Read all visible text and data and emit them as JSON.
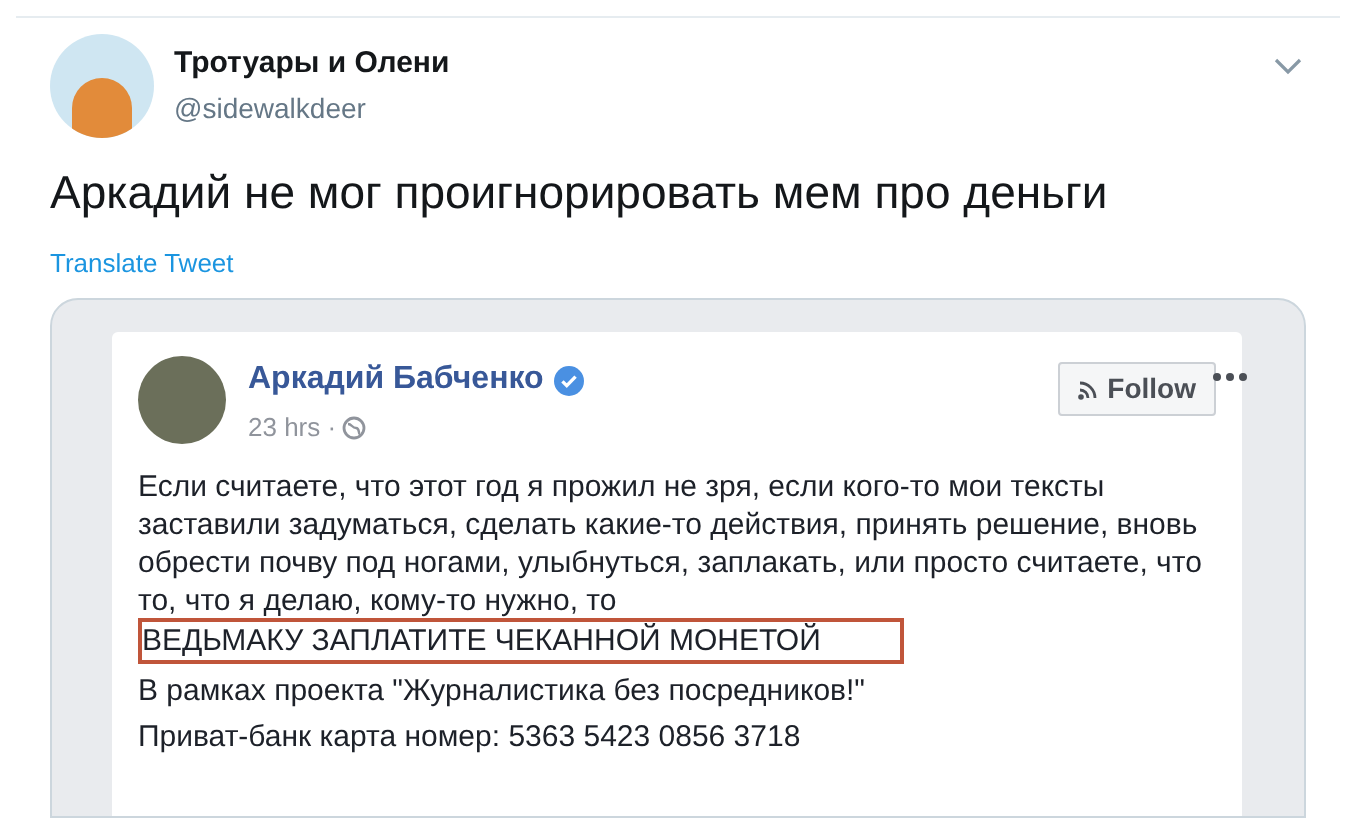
{
  "tweet": {
    "author": {
      "name": "Тротуары и Олени",
      "handle": "@sidewalkdeer"
    },
    "text": "Аркадий не мог проигнорировать мем про деньги",
    "translate_link": "Translate Tweet"
  },
  "embedded_post": {
    "author": {
      "name": "Аркадий Бабченко",
      "verified": true
    },
    "time": "23 hrs ·",
    "follow_button": "Follow",
    "paragraphs": [
      {
        "kind": "text",
        "text": "Если считаете, что этот год я прожил не зря, если кого-то мои тексты заставили задуматься, сделать какие-то действия, принять решение, вновь обрести почву под ногами, улыбнуться, заплакать, или просто считаете, что то, что я делаю, кому-то нужно, то"
      },
      {
        "kind": "highlighted",
        "text": "ВЕДЬМАКУ ЗАПЛАТИТЕ ЧЕКАННОЙ МОНЕТОЙ"
      },
      {
        "kind": "text",
        "text": "В рамках проекта \"Журналистика без посредников!\""
      },
      {
        "kind": "text",
        "text": "Приват-банк карта номер: 5363 5423 0856 3718"
      }
    ]
  }
}
